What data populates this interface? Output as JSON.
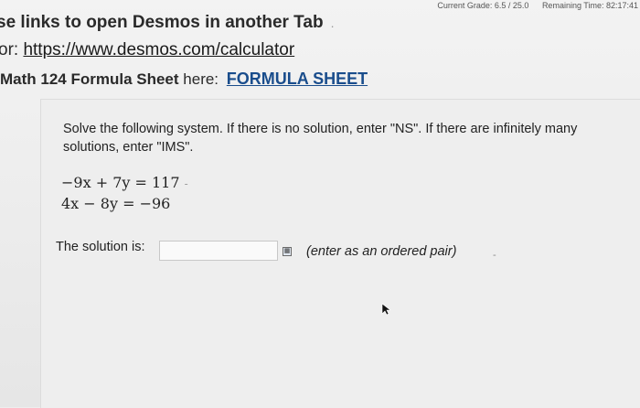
{
  "status": {
    "grade": "Current Grade: 6.5 / 25.0",
    "time": "Remaining Time: 82:17:41"
  },
  "instructions": {
    "line1": "se links to open Desmos in another Tab",
    "line1_dot": ".",
    "desmos_prefix": "or: ",
    "desmos_link": "https://www.desmos.com/calculator",
    "formula_prefix_bold": "Math 124 Formula Sheet",
    "formula_prefix_rest": " here:",
    "formula_link": "FORMULA SHEET"
  },
  "question": {
    "prompt": "Solve the following system. If there is no solution, enter \"NS\". If there are infinitely many solutions, enter \"IMS\".",
    "equation1": "−9x + 7y = 117",
    "equation2": "4x − 8y = −96",
    "solution_label": "The solution is:",
    "answer_value": "",
    "hint": "(enter as an ordered pair)"
  },
  "icons": {
    "entry": "equation-editor-icon",
    "cursor": "mouse-pointer-icon"
  },
  "colors": {
    "formula_link": "#1a4d8c",
    "background": "#ededed"
  }
}
